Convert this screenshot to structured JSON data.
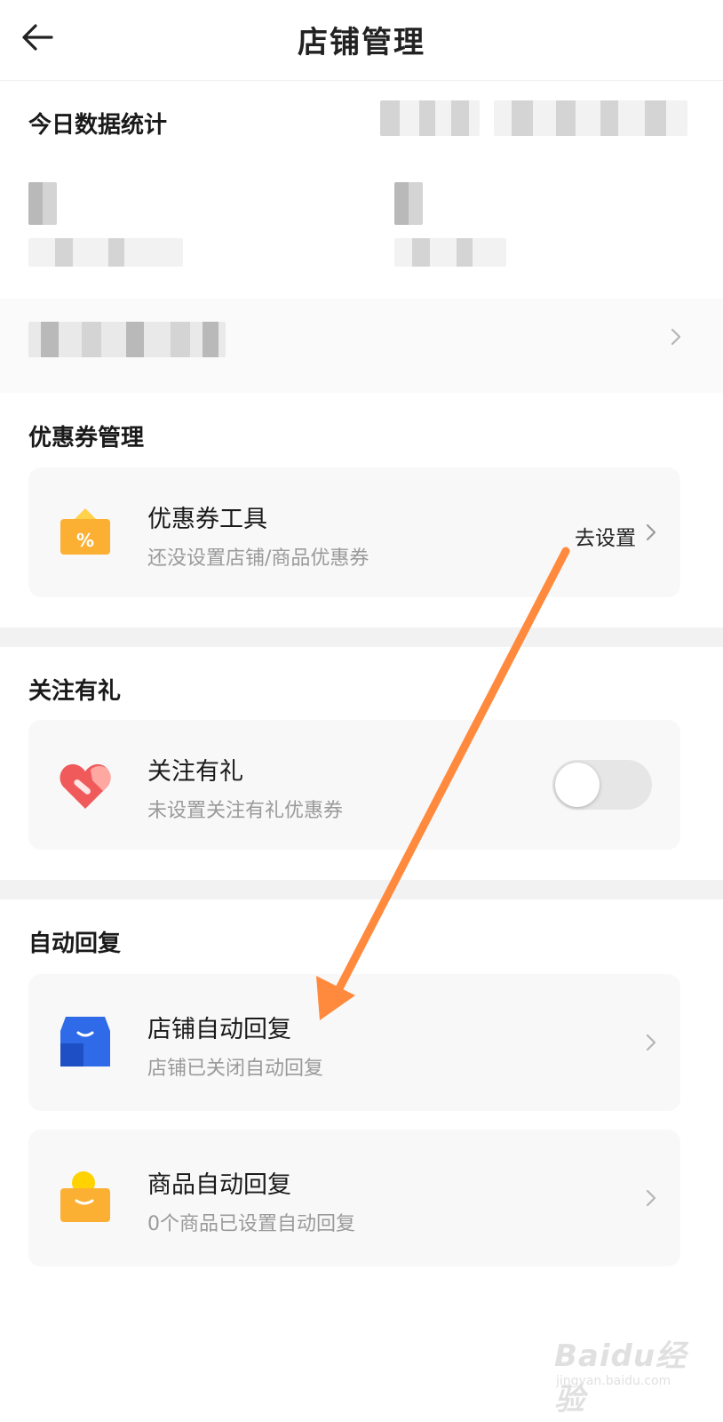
{
  "header": {
    "title": "店铺管理",
    "back_icon": "arrow-left-icon"
  },
  "stats": {
    "title": "今日数据统计"
  },
  "coupon": {
    "section_title": "优惠券管理",
    "card": {
      "title": "优惠券工具",
      "subtitle": "还没设置店铺/商品优惠券",
      "action_label": "去设置",
      "icon": "coupon-icon",
      "icon_glyph": "%",
      "color": "#FBB033"
    }
  },
  "follow": {
    "section_title": "关注有礼",
    "card": {
      "title": "关注有礼",
      "subtitle": "未设置关注有礼优惠券",
      "icon": "heart-gift-icon",
      "toggle_on": false,
      "color": "#F05A5A"
    }
  },
  "auto_reply": {
    "section_title": "自动回复",
    "items": [
      {
        "title": "店铺自动回复",
        "subtitle": "店铺已关闭自动回复",
        "icon": "store-icon",
        "color": "#2F6BE8"
      },
      {
        "title": "商品自动回复",
        "subtitle": "0个商品已设置自动回复",
        "icon": "shopping-bag-icon",
        "color": "#FBB033"
      }
    ]
  },
  "annotation": {
    "arrow_color": "#FF8A3D"
  },
  "watermark": {
    "brand": "Baidu经验",
    "url": "jingyan.baidu.com"
  }
}
